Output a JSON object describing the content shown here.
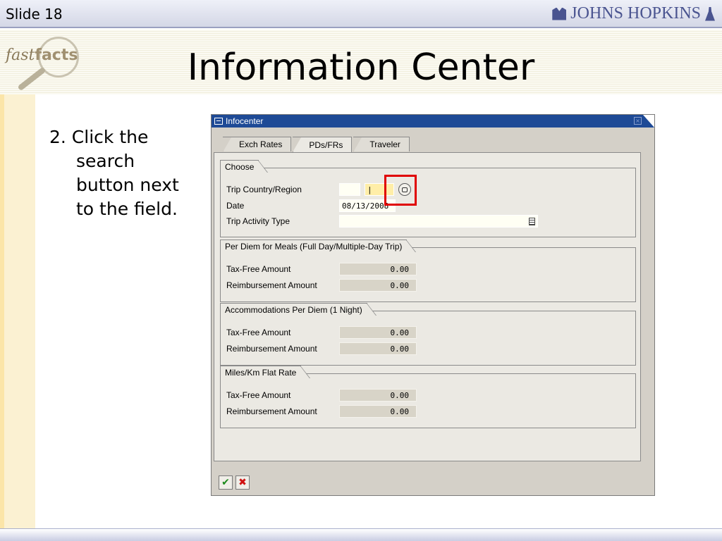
{
  "slide": {
    "number_label": "Slide 18",
    "title": "Information Center"
  },
  "branding": {
    "institution": "JOHNS HOPKINS",
    "fastfacts_italic": "fast",
    "fastfacts_bold": "facts"
  },
  "instruction": {
    "line1": "2. Click the",
    "line2": "search",
    "line3": "button next",
    "line4": "to the field."
  },
  "sap": {
    "window_title": "Infocenter",
    "tabs": [
      {
        "label": "Exch Rates"
      },
      {
        "label": "PDs/FRs"
      },
      {
        "label": "Traveler"
      }
    ],
    "choose": {
      "title": "Choose",
      "trip_country_label": "Trip Country/Region",
      "trip_country_value": "",
      "region_value": "|",
      "date_label": "Date",
      "date_value": "08/13/2008",
      "activity_label": "Trip Activity Type",
      "activity_value": ""
    },
    "meals": {
      "title": "Per Diem for Meals (Full Day/Multiple-Day Trip)",
      "tax_free_label": "Tax-Free Amount",
      "tax_free_value": "0.00",
      "reimb_label": "Reimbursement Amount",
      "reimb_value": "0.00"
    },
    "accommodations": {
      "title": "Accommodations Per Diem (1 Night)",
      "tax_free_label": "Tax-Free Amount",
      "tax_free_value": "0.00",
      "reimb_label": "Reimbursement Amount",
      "reimb_value": "0.00"
    },
    "miles": {
      "title": "Miles/Km Flat Rate",
      "tax_free_label": "Tax-Free Amount",
      "tax_free_value": "0.00",
      "reimb_label": "Reimbursement Amount",
      "reimb_value": "0.00"
    },
    "footer": {
      "ok_symbol": "✔",
      "cancel_symbol": "✖"
    }
  }
}
